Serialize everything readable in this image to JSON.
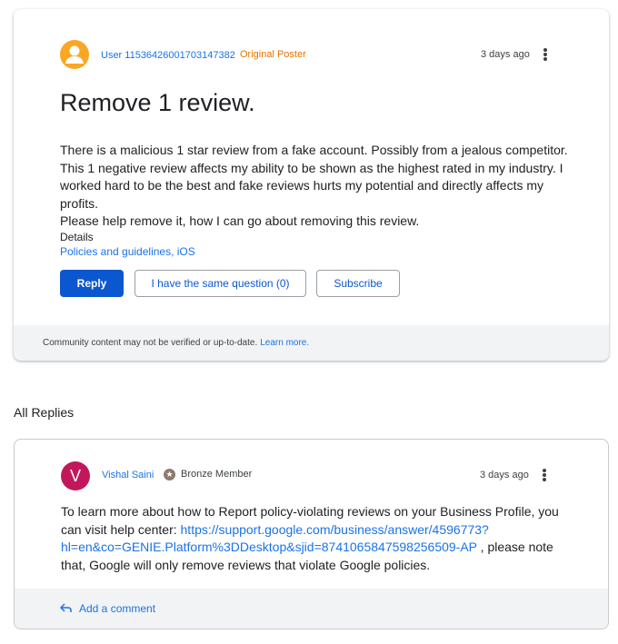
{
  "question": {
    "author": "User 11536426001703147382",
    "author_badge": "Original Poster",
    "time": "3 days ago",
    "title": "Remove 1 review.",
    "body": "There is a malicious 1 star review from a fake account.  Possibly from a jealous competitor.\n This 1 negative review affects my ability to be shown as the highest rated in my industry.  I worked hard to be the best and fake reviews hurts my potential and directly affects my profits.\n Please help remove it, how I can go about removing this review.",
    "details_label": "Details",
    "details_value": "Policies and guidelines, iOS",
    "reply_label": "Reply",
    "same_question_label": "I have the same question (0)",
    "subscribe_label": "Subscribe",
    "footer_text": "Community content may not be verified or up-to-date.",
    "footer_link": "Learn more."
  },
  "replies_heading": "All Replies",
  "reply": {
    "avatar_letter": "V",
    "author": "Vishal Saini",
    "member_level": "Bronze Member",
    "time": "3 days ago",
    "text_before": "To learn more about how to Report policy-violating reviews on your Business Profile, you can visit help center: ",
    "link": "https://support.google.com/business/answer/4596773?hl=en&co=GENIE.Platform%3DDesktop&sjid=8741065847598256509-AP",
    "text_after": " , please note that, Google will only remove reviews that violate Google policies.",
    "add_comment_label": "Add a comment"
  },
  "colors": {
    "accent": "#1a73e8",
    "primary_button": "#0b57d0",
    "op_badge": "#e37400",
    "user_avatar": "#f9a825",
    "reply_avatar": "#c2185b"
  },
  "icons": {
    "user_avatar": "person-icon",
    "menu": "more-vert-icon",
    "member_badge": "star-badge-icon",
    "add_comment": "reply-arrow-icon"
  }
}
